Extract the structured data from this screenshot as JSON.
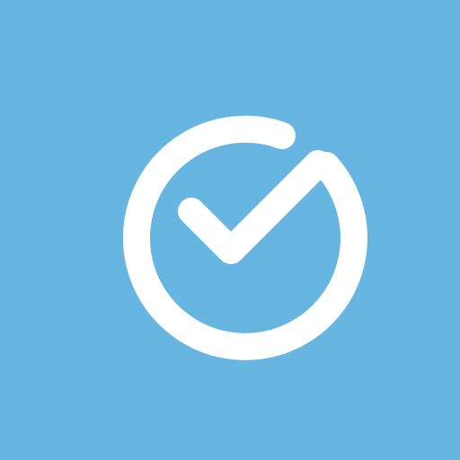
{
  "app_icon": {
    "icon": "check-circle-icon",
    "background_color": "#66B6E1",
    "glyph_color": "#FFFFFF"
  }
}
